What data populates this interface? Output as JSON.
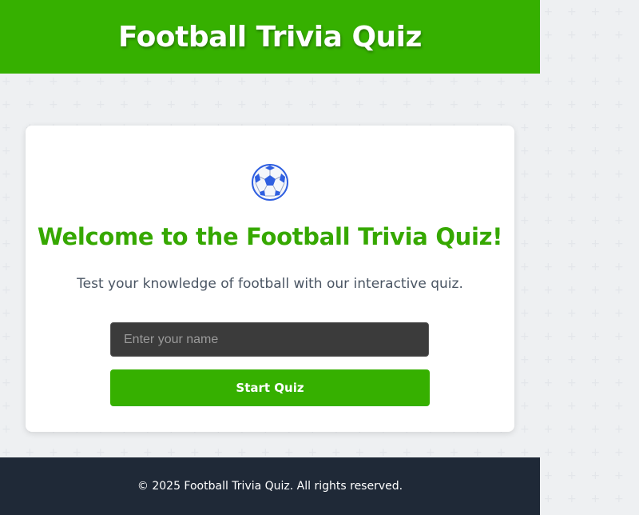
{
  "header": {
    "title": "Football Trivia Quiz"
  },
  "card": {
    "icon": "soccer-ball-icon",
    "welcome": "Welcome to the Football Trivia Quiz!",
    "subtitle": "Test your knowledge of football with our interactive quiz.",
    "name_input": {
      "value": "",
      "placeholder": "Enter your name"
    },
    "start_button_label": "Start Quiz"
  },
  "footer": {
    "copyright": "© 2025 Football Trivia Quiz. All rights reserved."
  },
  "colors": {
    "brand_green": "#36b000",
    "footer_bg": "#1f2937",
    "input_bg": "#3b3b3b"
  }
}
